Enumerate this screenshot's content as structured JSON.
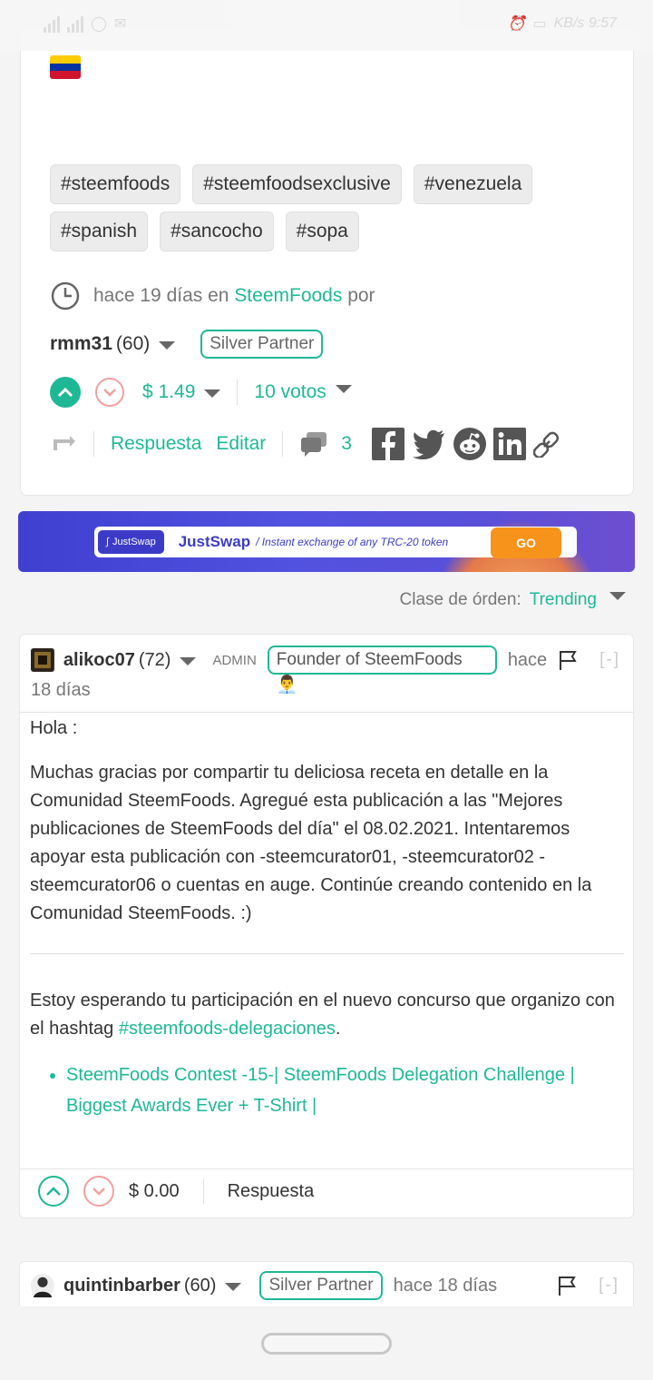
{
  "status_bar": {
    "left": "4G 4G",
    "right": "KB/s 9:57"
  },
  "post": {
    "tags": [
      "#steemfoods",
      "#steemfoodsexclusive",
      "#venezuela",
      "#spanish",
      "#sancocho",
      "#sopa"
    ],
    "meta": {
      "time": "hace 19 días en",
      "community": "SteemFoods",
      "by": "por"
    },
    "author": {
      "name": "rmm31",
      "reputation": "(60)",
      "badge": "Silver Partner"
    },
    "payout": "$ 1.49",
    "votes": "10 votos",
    "actions": {
      "reply": "Respuesta",
      "edit": "Editar",
      "comments_count": "3"
    }
  },
  "banner": {
    "pill": "JustSwap",
    "name": "JustSwap",
    "tagline": "/ Instant exchange of any TRC-20 token",
    "cta": "GO"
  },
  "sort": {
    "label": "Clase de órden:",
    "value": "Trending"
  },
  "comment1": {
    "author": "alikoc07",
    "reputation": "(72)",
    "role": "ADMIN",
    "badge": "Founder of SteemFoods 👨‍💼",
    "time_a": "hace",
    "time_b": "18 días",
    "collapse": "[-]",
    "greeting": "Hola :",
    "para1": "Muchas gracias por compartir tu deliciosa receta en detalle en la Comunidad SteemFoods. Agregué esta publicación a las \"Mejores publicaciones de SteemFoods del día\" el 08.02.2021. Intentaremos apoyar esta publicación con -steemcurator01, -steemcurator02 -steemcurator06 o cuentas en auge. Continúe creando contenido en la Comunidad SteemFoods. :)",
    "para2_prefix": "Estoy esperando tu participación en el nuevo concurso que organizo con el hashtag ",
    "para2_link": "#steemfoods-delegaciones",
    "para2_suffix": ".",
    "list_link": "SteemFoods Contest -15-| SteemFoods Delegation Challenge | Biggest Awards Ever + T-Shirt |",
    "payout": "$ 0.00",
    "reply": "Respuesta"
  },
  "comment2": {
    "author": "quintinbarber",
    "reputation": "(60)",
    "badge": "Silver Partner",
    "time": "hace 18 días",
    "collapse": "[-]"
  },
  "colors": {
    "accent": "#1fb895",
    "downvote": "#f0a0a0",
    "banner": "#4a4ad8",
    "go": "#f7931a"
  }
}
